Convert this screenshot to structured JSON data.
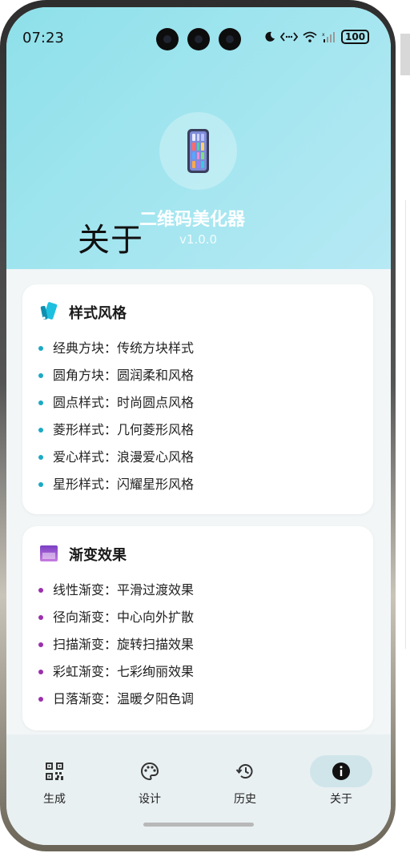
{
  "status_bar": {
    "time": "07:23",
    "battery": "100"
  },
  "header": {
    "page_title": "关于",
    "app_name": "二维码美化器",
    "app_version": "v1.0.0"
  },
  "sections": [
    {
      "title": "样式风格",
      "icon": "palette-swatch-icon",
      "bullet_color": "#1ba9c5",
      "items": [
        "经典方块：传统方块样式",
        "圆角方块：圆润柔和风格",
        "圆点样式：时尚圆点风格",
        "菱形样式：几何菱形风格",
        "爱心样式：浪漫爱心风格",
        "星形样式：闪耀星形风格"
      ]
    },
    {
      "title": "渐变效果",
      "icon": "gradient-icon",
      "bullet_color": "#9b2fae",
      "items": [
        "线性渐变：平滑过渡效果",
        "径向渐变：中心向外扩散",
        "扫描渐变：旋转扫描效果",
        "彩虹渐变：七彩绚丽效果",
        "日落渐变：温暖夕阳色调"
      ]
    }
  ],
  "nav": {
    "items": [
      {
        "label": "生成",
        "icon": "qr-code-icon"
      },
      {
        "label": "设计",
        "icon": "palette-icon"
      },
      {
        "label": "历史",
        "icon": "history-icon"
      },
      {
        "label": "关于",
        "icon": "info-icon"
      }
    ],
    "active_index": 3
  },
  "colors": {
    "header_bg": "#9ee3ee",
    "accent": "#1ba9c5",
    "active_pill": "#cfe5ea"
  }
}
